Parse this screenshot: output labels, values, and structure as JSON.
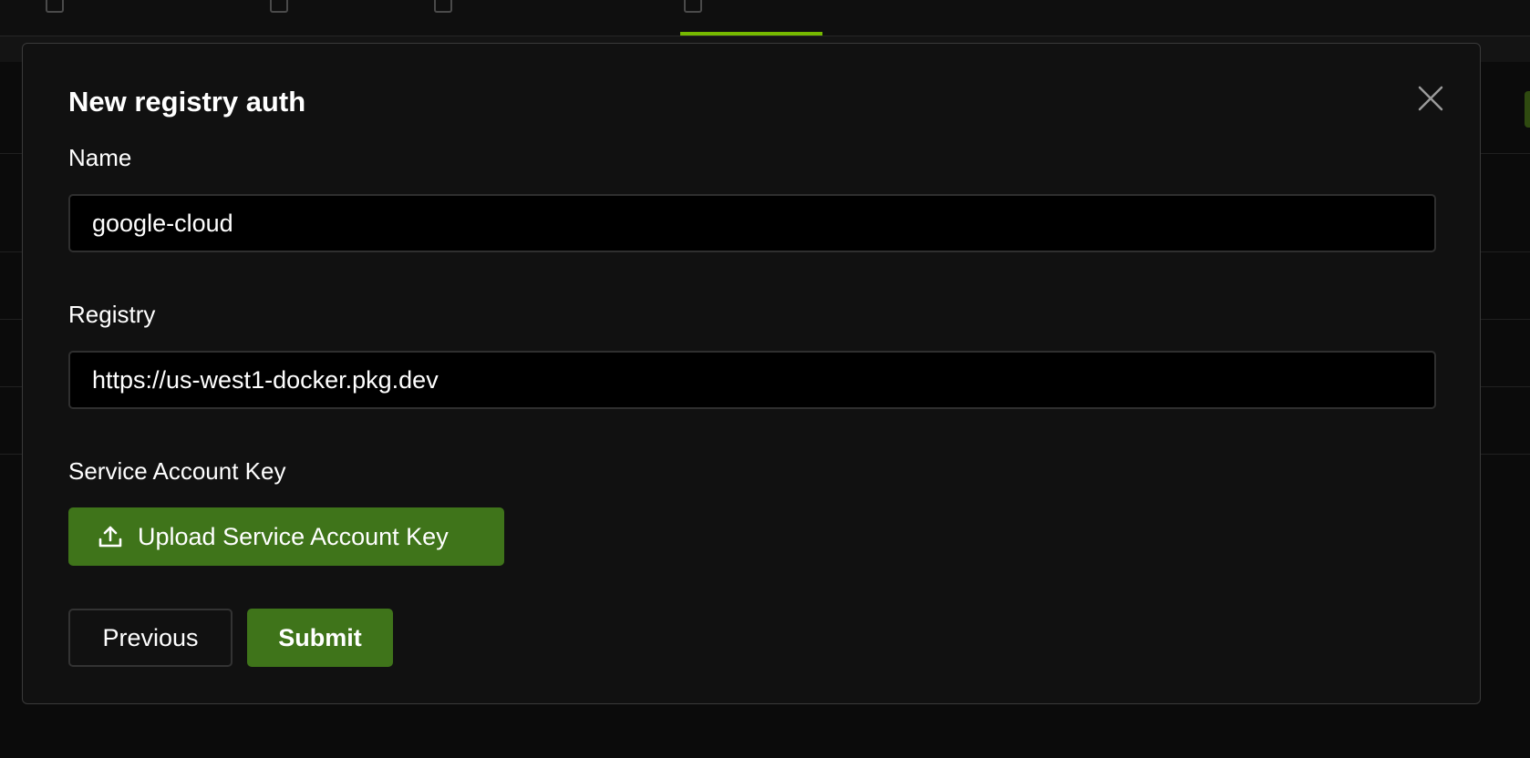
{
  "modal": {
    "title": "New registry auth",
    "close_icon": "close-icon",
    "name_label": "Name",
    "name_value": "google-cloud",
    "registry_label": "Registry",
    "registry_value": "https://us-west1-docker.pkg.dev",
    "key_label": "Service Account Key",
    "upload_label": "Upload Service Account Key",
    "upload_icon": "upload-icon",
    "previous_label": "Previous",
    "submit_label": "Submit"
  },
  "colors": {
    "accent": "#76b900",
    "button_green": "#3f741a",
    "modal_bg": "#111111",
    "input_bg": "#000000"
  }
}
